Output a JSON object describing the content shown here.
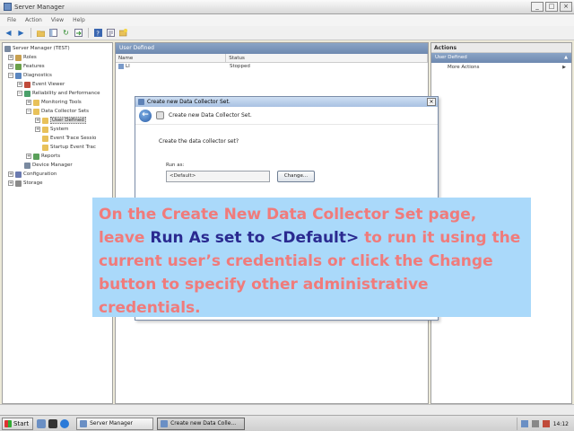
{
  "window": {
    "title": "Server Manager",
    "buttons": {
      "minimize": "_",
      "maximize": "□",
      "close": "×"
    }
  },
  "menu": {
    "items": [
      "File",
      "Action",
      "View",
      "Help"
    ]
  },
  "toolbar": {
    "icons": [
      "back-arrow",
      "forward-arrow",
      "up-folder",
      "show-hide-tree",
      "refresh",
      "export",
      "help",
      "properties",
      "new"
    ]
  },
  "tree": {
    "items": [
      {
        "label": "Server Manager (TEST)",
        "expander": ""
      },
      {
        "label": "Roles",
        "expander": "+"
      },
      {
        "label": "Features",
        "expander": "+"
      },
      {
        "label": "Diagnostics",
        "expander": "−"
      },
      {
        "label": "Event Viewer",
        "expander": "+"
      },
      {
        "label": "Reliability and Performance",
        "expander": "−"
      },
      {
        "label": "Monitoring Tools",
        "expander": "+"
      },
      {
        "label": "Data Collector Sets",
        "expander": "−"
      },
      {
        "label": "User Defined",
        "expander": "+"
      },
      {
        "label": "System",
        "expander": "+"
      },
      {
        "label": "Event Trace Sessio",
        "expander": ""
      },
      {
        "label": "Startup Event Trac",
        "expander": ""
      },
      {
        "label": "Reports",
        "expander": "+"
      },
      {
        "label": "Device Manager",
        "expander": ""
      },
      {
        "label": "Configuration",
        "expander": "+"
      },
      {
        "label": "Storage",
        "expander": "+"
      }
    ]
  },
  "center": {
    "header": "User Defined",
    "columns": [
      "Name",
      "Status"
    ],
    "rows": [
      {
        "name": "LI",
        "status": "Stopped"
      }
    ]
  },
  "actions": {
    "header": "Actions",
    "section": "User Defined",
    "items": [
      {
        "label": "More Actions"
      }
    ]
  },
  "dialog": {
    "title": "Create new Data Collector Set.",
    "header": "Create new Data Collector Set.",
    "question": "Create the data collector set?",
    "run_as_label": "Run as:",
    "run_as_value": "<Default>",
    "change_button": "Change..."
  },
  "callout": {
    "part1": "On the Create New Data Collector Set page, leave ",
    "highlight": "Run As set to <Default>",
    "part2": " to run it using the current user’s credentials or click the Change button to specify other administrative credentials.",
    "colors": {
      "background": "#aad9fa",
      "text": "#f07b7b",
      "highlight": "#2a2a90"
    }
  },
  "taskbar": {
    "start_label": "Start",
    "tasks": [
      "Server Manager",
      "Create new Data Colle..."
    ],
    "clock": "14:12"
  }
}
